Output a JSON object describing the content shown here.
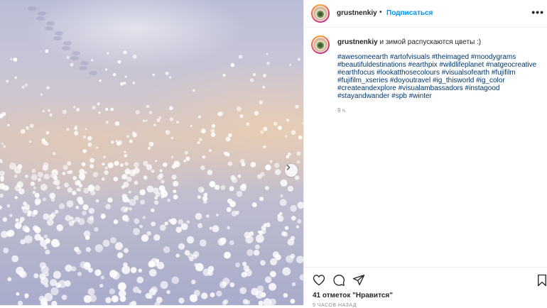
{
  "post": {
    "username": "grustnenkiy",
    "separator": "•",
    "follow_label": "Подписаться",
    "more_label": "•••",
    "caption_text": "и зимой распускаются цветы :)",
    "hashtag_lines": [
      "#awesomeearth #artofvisuals #theimaged #moodygrams",
      "#beautifuldestinations #earthpix #wildlifeplanet #natgeocreative",
      "#earthfocus #lookatthosecolours #visualsofearth #fujifilm",
      "#fujifilm_xseries #doyoutravel #ig_thisworld #ig_color",
      "#createandexplore #visualambassadors #instagood",
      "#stayandwander #spb #winter"
    ],
    "caption_time": "9 ч.",
    "likes_text": "41 отметок \"Нравится\"",
    "posted_ago": "9 ЧАСОВ НАЗАД"
  },
  "icons": {
    "next": "chevron-right-icon",
    "like": "heart-icon",
    "comment": "comment-icon",
    "share": "paper-plane-icon",
    "save": "bookmark-icon"
  },
  "colors": {
    "link": "#0095f6",
    "hashtag": "#00376b",
    "muted": "#8e8e8e"
  }
}
